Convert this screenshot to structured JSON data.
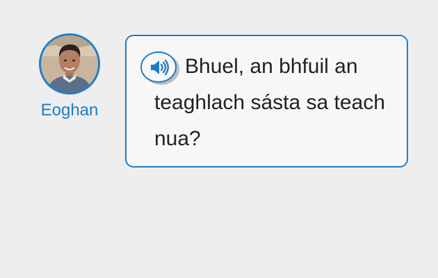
{
  "speaker": {
    "name": "Eoghan",
    "avatar": "portrait of Eoghan"
  },
  "message": {
    "text": "Bhuel, an bhfuil an teaghlach sásta sa teach nua?",
    "audio_icon": "speaker-volume-icon"
  },
  "colors": {
    "accent": "#1f7dc4",
    "background": "#eeeeee",
    "bubble": "#f7f7f7",
    "text": "#222222"
  }
}
